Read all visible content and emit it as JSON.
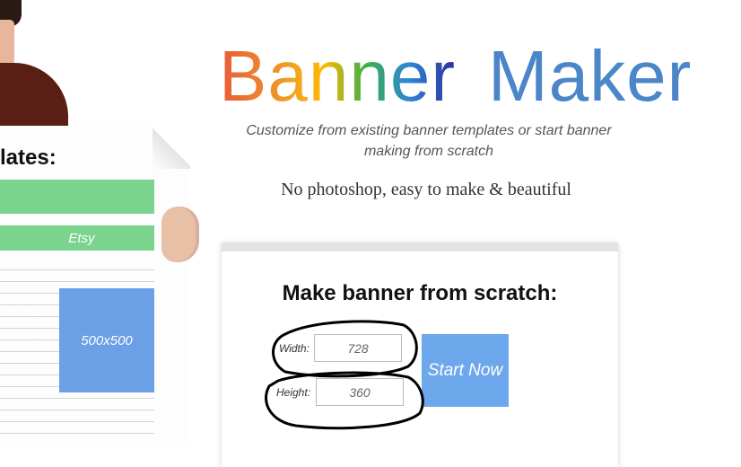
{
  "header": {
    "logo": {
      "part1": "Banner",
      "part2": "Maker"
    },
    "subtitle": "Customize from existing banner templates or start banner making from scratch",
    "tagline": "No photoshop, easy to make & beautiful"
  },
  "templates_board": {
    "title": "lates:",
    "items": [
      {
        "label": ""
      },
      {
        "label": "Etsy"
      },
      {
        "label": "500x500"
      }
    ]
  },
  "scratch_form": {
    "title": "Make banner from scratch:",
    "width_label": "Width:",
    "width_value": "728",
    "height_label": "Height:",
    "height_value": "360",
    "start_button": "Start Now"
  },
  "colors": {
    "green_bar": "#7ad48e",
    "blue_tile": "#6b9fe6",
    "start_button": "#6ea8ec"
  },
  "icons": []
}
